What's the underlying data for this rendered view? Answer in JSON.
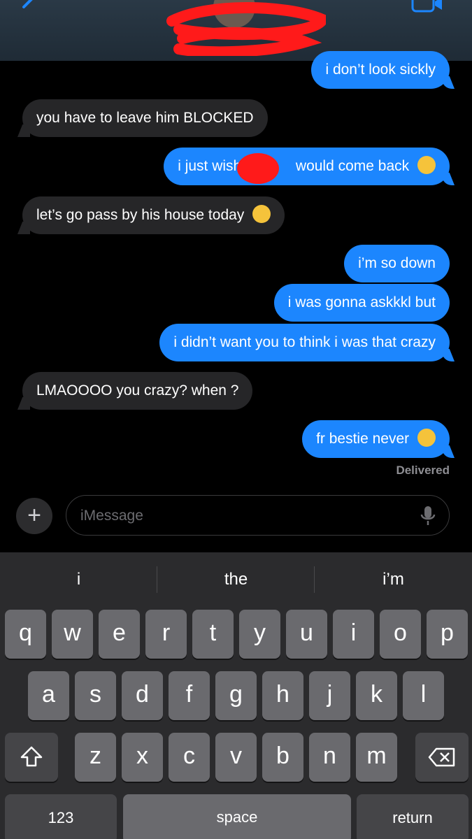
{
  "header": {
    "contact_name": "",
    "icons": [
      "chevron-left-icon",
      "video-camera-icon"
    ]
  },
  "messages": [
    {
      "side": "sent",
      "text": "i don’t look sickly"
    },
    {
      "side": "received",
      "text": "you have to leave him BLOCKED"
    },
    {
      "side": "sent",
      "text_before": "i just wish",
      "text_after": "would come back",
      "emoji": "smiling-face-with-tear"
    },
    {
      "side": "received",
      "text": "let’s go pass by his house today",
      "emoji": "face-with-tears-of-joy"
    },
    {
      "side": "sent",
      "text": "i’m so down"
    },
    {
      "side": "sent",
      "text": "i was gonna askkkl but"
    },
    {
      "side": "sent",
      "text": "i didn’t want you to think i was that crazy"
    },
    {
      "side": "received",
      "text": "LMAOOOO you crazy? when ?"
    },
    {
      "side": "sent",
      "text": "fr bestie never",
      "emoji": "smiling-face-with-tear"
    }
  ],
  "status": "Delivered",
  "input": {
    "placeholder": "iMessage",
    "value": ""
  },
  "suggestions": [
    "i",
    "the",
    "i’m"
  ],
  "keyboard": {
    "row1": [
      "q",
      "w",
      "e",
      "r",
      "t",
      "y",
      "u",
      "i",
      "o",
      "p"
    ],
    "row2": [
      "a",
      "s",
      "d",
      "f",
      "g",
      "h",
      "j",
      "k",
      "l"
    ],
    "row3": [
      "z",
      "x",
      "c",
      "v",
      "b",
      "n",
      "m"
    ],
    "numbers_label": "123",
    "space_label": "space",
    "return_label": "return"
  },
  "colors": {
    "sent_bubble": "#1c86fe",
    "received_bubble": "#262628",
    "redaction": "#ff1a1a"
  }
}
